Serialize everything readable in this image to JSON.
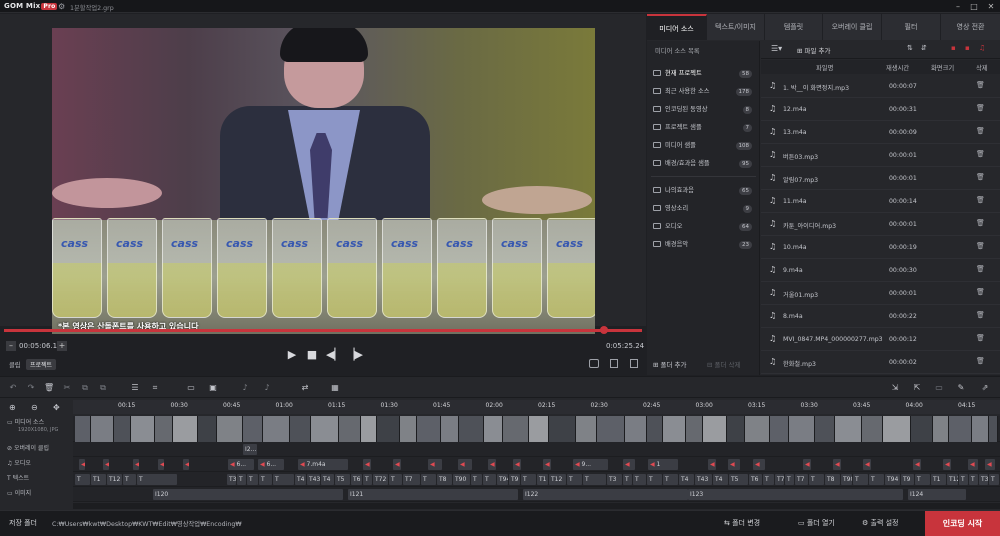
{
  "titlebar": {
    "app_name": "GOM Mix",
    "app_badge": "Pro",
    "file_name": "1분할작업2.grp"
  },
  "preview": {
    "subtitle": "*본 영상은 산돌폰트를 사용하고 있습니다",
    "glass_mark": "cass",
    "current_time": "00:05:06.13",
    "total_time": "0:05:25.24",
    "progress_fraction": 0.94,
    "mode_clip": "클립",
    "mode_project": "프로젝트"
  },
  "tabs": [
    "미디어 소스",
    "텍스트/이미지",
    "템플릿",
    "오버레이 클립",
    "필터",
    "영상 전환"
  ],
  "media_sources": {
    "header": "미디어 소스 목록",
    "items": [
      {
        "label": "현재 프로젝트",
        "count": "58"
      },
      {
        "label": "최근 사용한 소스",
        "count": "178"
      },
      {
        "label": "인코딩된 동영상",
        "count": "8"
      },
      {
        "label": "프로젝트 샘플",
        "count": "7"
      },
      {
        "label": "미디어 샘플",
        "count": "108"
      },
      {
        "label": "배경/효과음 샘플",
        "count": "95"
      },
      {
        "label": "나의효과음",
        "count": "65"
      },
      {
        "label": "영상소리",
        "count": "9"
      },
      {
        "label": "오디오",
        "count": "64"
      },
      {
        "label": "배경음악",
        "count": "23"
      }
    ],
    "add_folder": "폴더 추가",
    "delete_folder": "폴더 삭제"
  },
  "file_list": {
    "add_file": "파일 추가",
    "columns": {
      "name": "파일명",
      "duration": "재생시간",
      "resolution": "화면크기",
      "delete": "삭제"
    },
    "rows": [
      {
        "name": "1. 박__이 화면정지.mp3",
        "duration": "00:00:07"
      },
      {
        "name": "12.m4a",
        "duration": "00:00:31"
      },
      {
        "name": "13.m4a",
        "duration": "00:00:09"
      },
      {
        "name": "버튼03.mp3",
        "duration": "00:00:01"
      },
      {
        "name": "알림07.mp3",
        "duration": "00:00:01"
      },
      {
        "name": "11.m4a",
        "duration": "00:00:14"
      },
      {
        "name": "카툰_아이디어.mp3",
        "duration": "00:00:01"
      },
      {
        "name": "10.m4a",
        "duration": "00:00:19"
      },
      {
        "name": "9.m4a",
        "duration": "00:00:30"
      },
      {
        "name": "거울01.mp3",
        "duration": "00:00:01"
      },
      {
        "name": "8.m4a",
        "duration": "00:00:22"
      },
      {
        "name": "MVI_0847.MP4_000000277.mp3",
        "duration": "00:00:12"
      },
      {
        "name": "한화철.mp3",
        "duration": "00:00:02"
      }
    ]
  },
  "timeline": {
    "ruler": [
      "00:15",
      "00:30",
      "00:45",
      "01:00",
      "01:15",
      "01:30",
      "01:45",
      "02:00",
      "02:15",
      "02:30",
      "02:45",
      "03:00",
      "03:15",
      "03:30",
      "03:45",
      "04:00",
      "04:15"
    ],
    "tracks": {
      "media": "미디어 소스",
      "media_sub": "1920X1080, JPG",
      "overlay": "오버레이 클립",
      "audio": "오디오",
      "text": "텍스트",
      "image": "이미지"
    },
    "audio_clips": [
      "6...",
      "6...",
      "7.m4a",
      "9...",
      "1"
    ],
    "text_clips": [
      "T",
      "T1",
      "T12",
      "T",
      "T",
      "T3",
      "T",
      "T",
      "T",
      "T",
      "T4",
      "T43",
      "T4",
      "T5",
      "T6",
      "T",
      "T72",
      "T",
      "T7",
      "T",
      "T8",
      "T90",
      "T",
      "T",
      "T94",
      "T9"
    ],
    "image_clips": [
      "I120",
      "I121",
      "I122",
      "I123",
      "I124"
    ],
    "overlay_clip": "I2..."
  },
  "statusbar": {
    "save_folder_label": "저장 폴더",
    "save_path": "C:₩Users₩kwt₩Desktop₩KWT₩Edit₩영상작업₩Encoding₩",
    "change_folder": "폴더 변경",
    "open_folder": "폴더 열기",
    "output_settings": "출력 설정",
    "start_encoding": "인코딩 시작"
  }
}
